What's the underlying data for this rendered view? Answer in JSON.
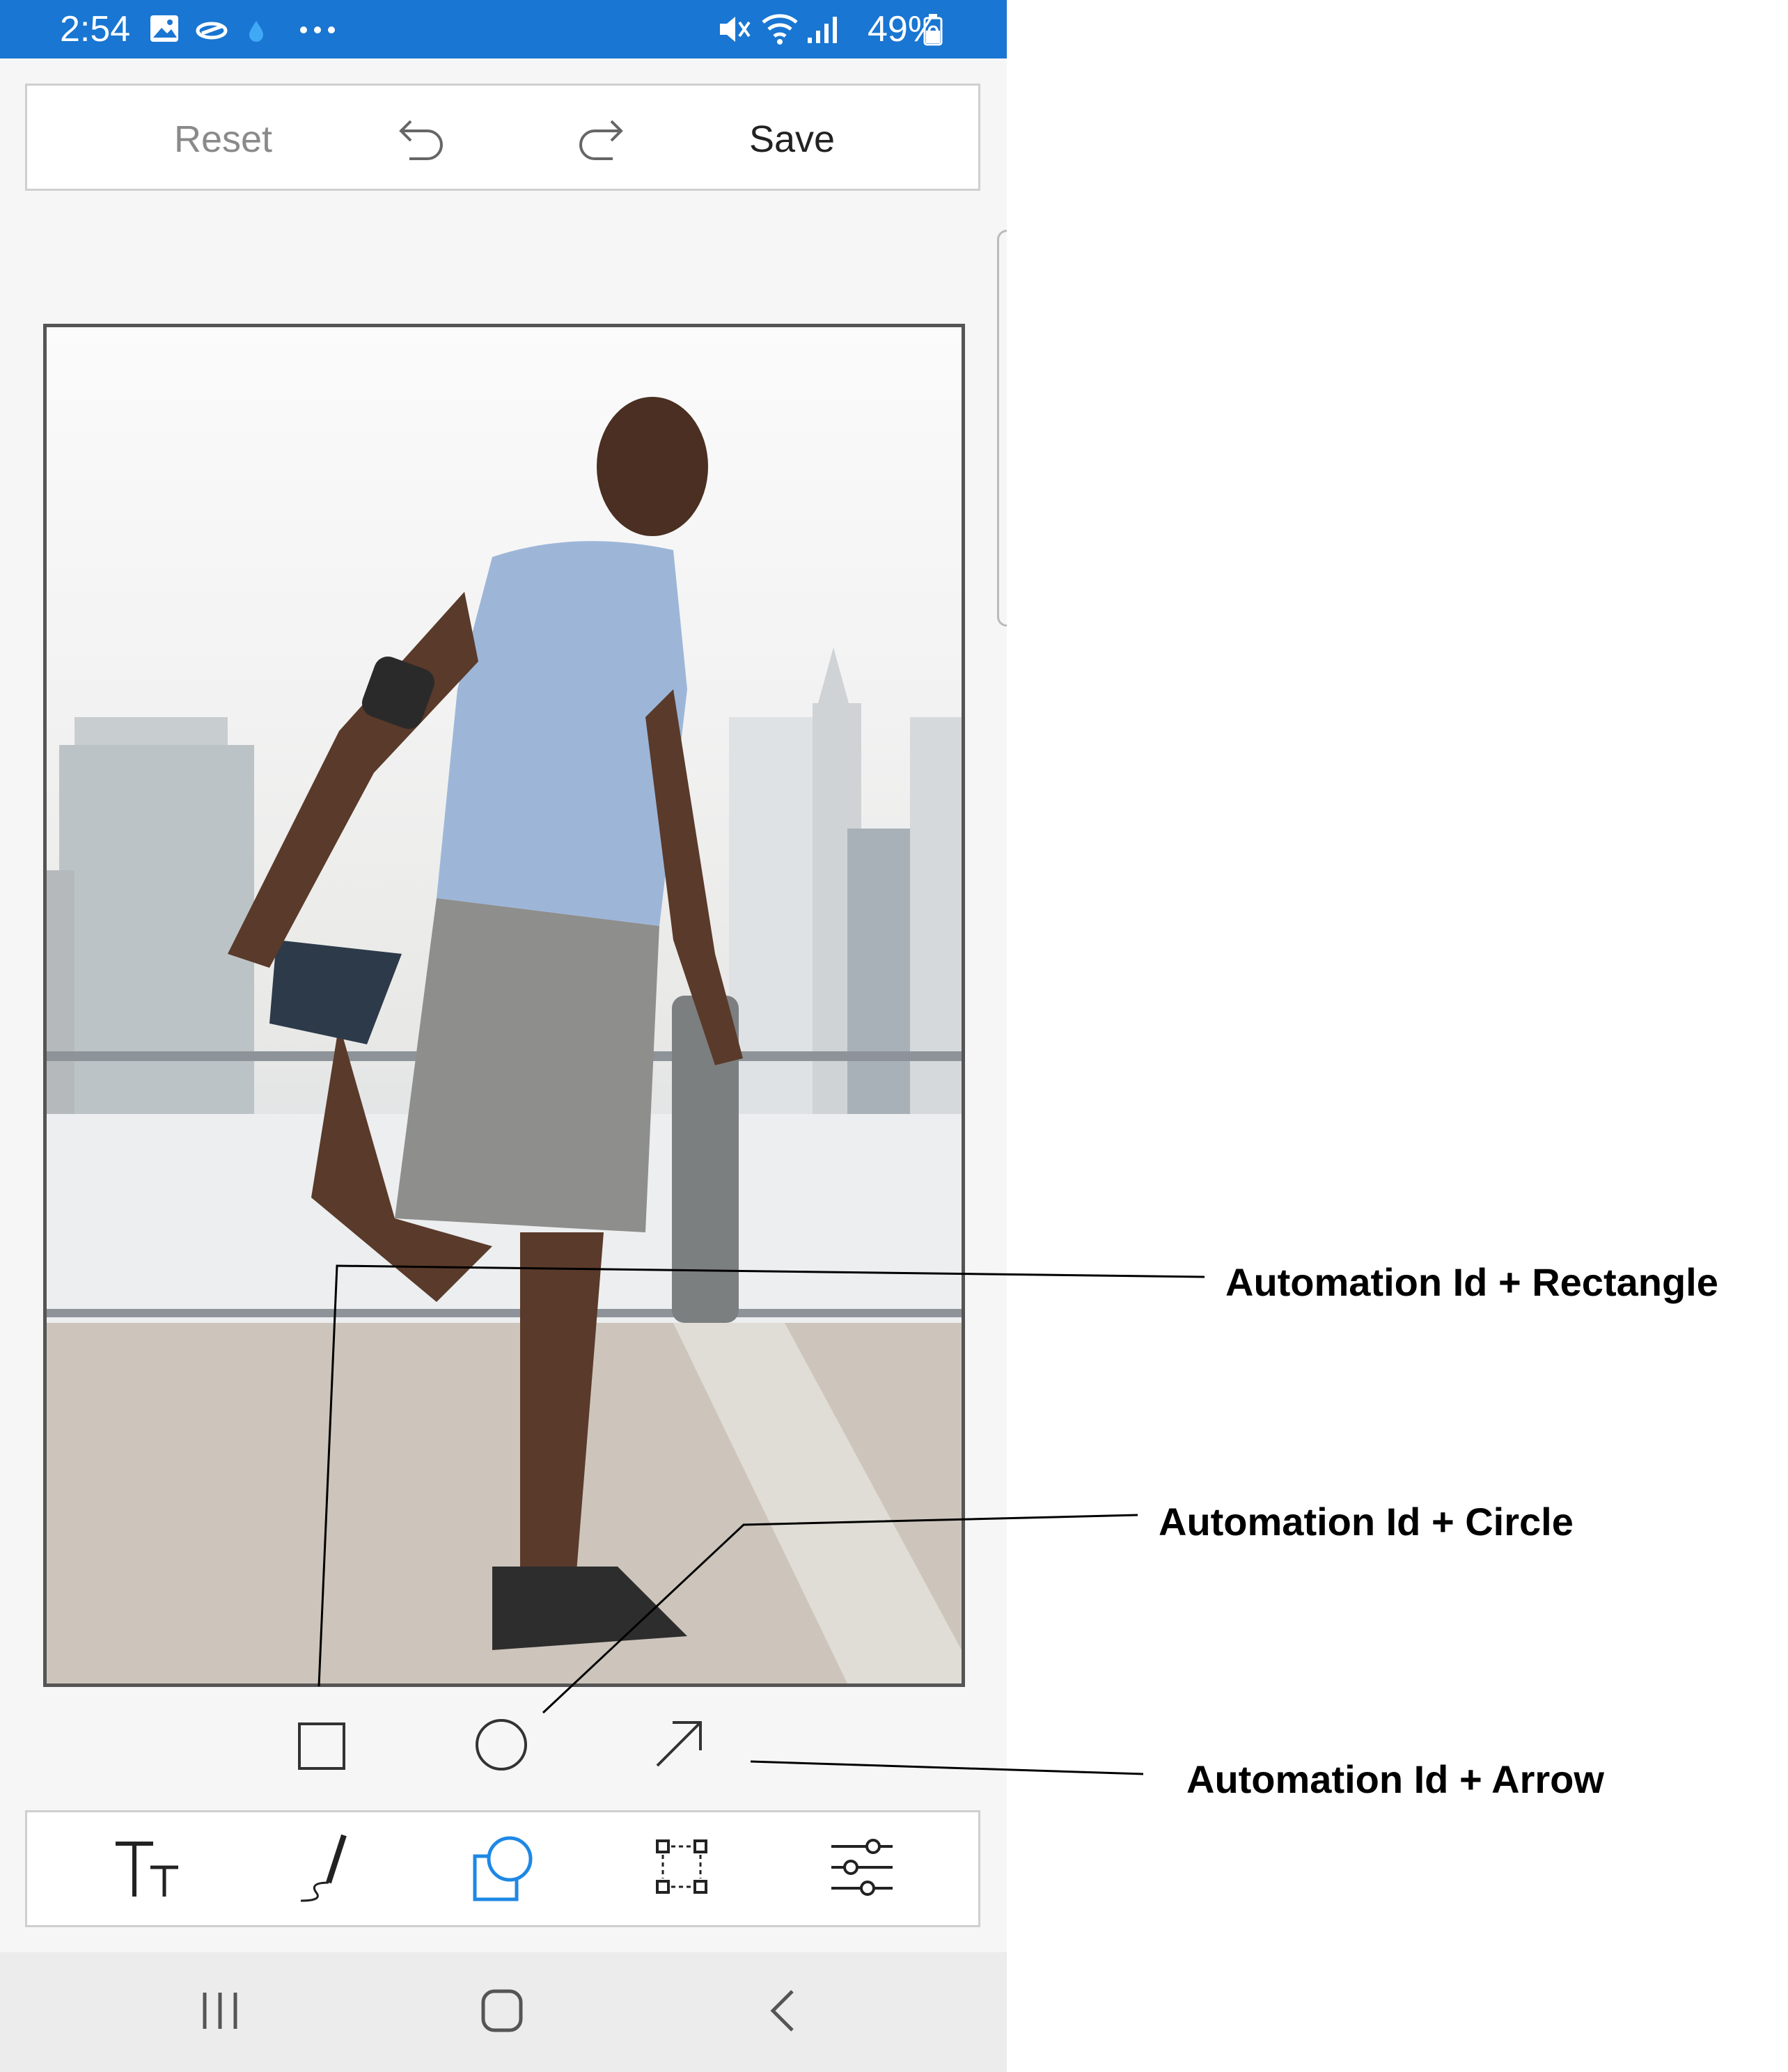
{
  "status_bar": {
    "time": "2:54",
    "battery": "49%",
    "icons": [
      "gallery-icon",
      "cloud-sync-icon",
      "dot-icon",
      "more-icon",
      "mute-icon",
      "wifi-icon",
      "signal-icon",
      "battery-icon"
    ]
  },
  "toolbar": {
    "reset_label": "Reset",
    "undo_icon": "undo-icon",
    "redo_icon": "redo-icon",
    "save_label": "Save"
  },
  "photo": {
    "description_icon": "runner-photo"
  },
  "shape_tools": [
    {
      "icon": "rectangle-icon"
    },
    {
      "icon": "circle-icon"
    },
    {
      "icon": "arrow-icon"
    }
  ],
  "bottom_tools": [
    {
      "icon": "text-tool-icon"
    },
    {
      "icon": "pen-tool-icon"
    },
    {
      "icon": "shapes-tool-icon",
      "selected": true
    },
    {
      "icon": "crop-tool-icon"
    },
    {
      "icon": "adjust-tool-icon"
    }
  ],
  "nav_bar": [
    "recent-apps-icon",
    "home-icon",
    "back-icon"
  ],
  "callouts": {
    "rectangle": "Automation Id + Rectangle",
    "circle": "Automation Id + Circle",
    "arrow": "Automation Id + Arrow"
  },
  "colors": {
    "status_bar": "#1976d2",
    "accent": "#1e88e5"
  }
}
